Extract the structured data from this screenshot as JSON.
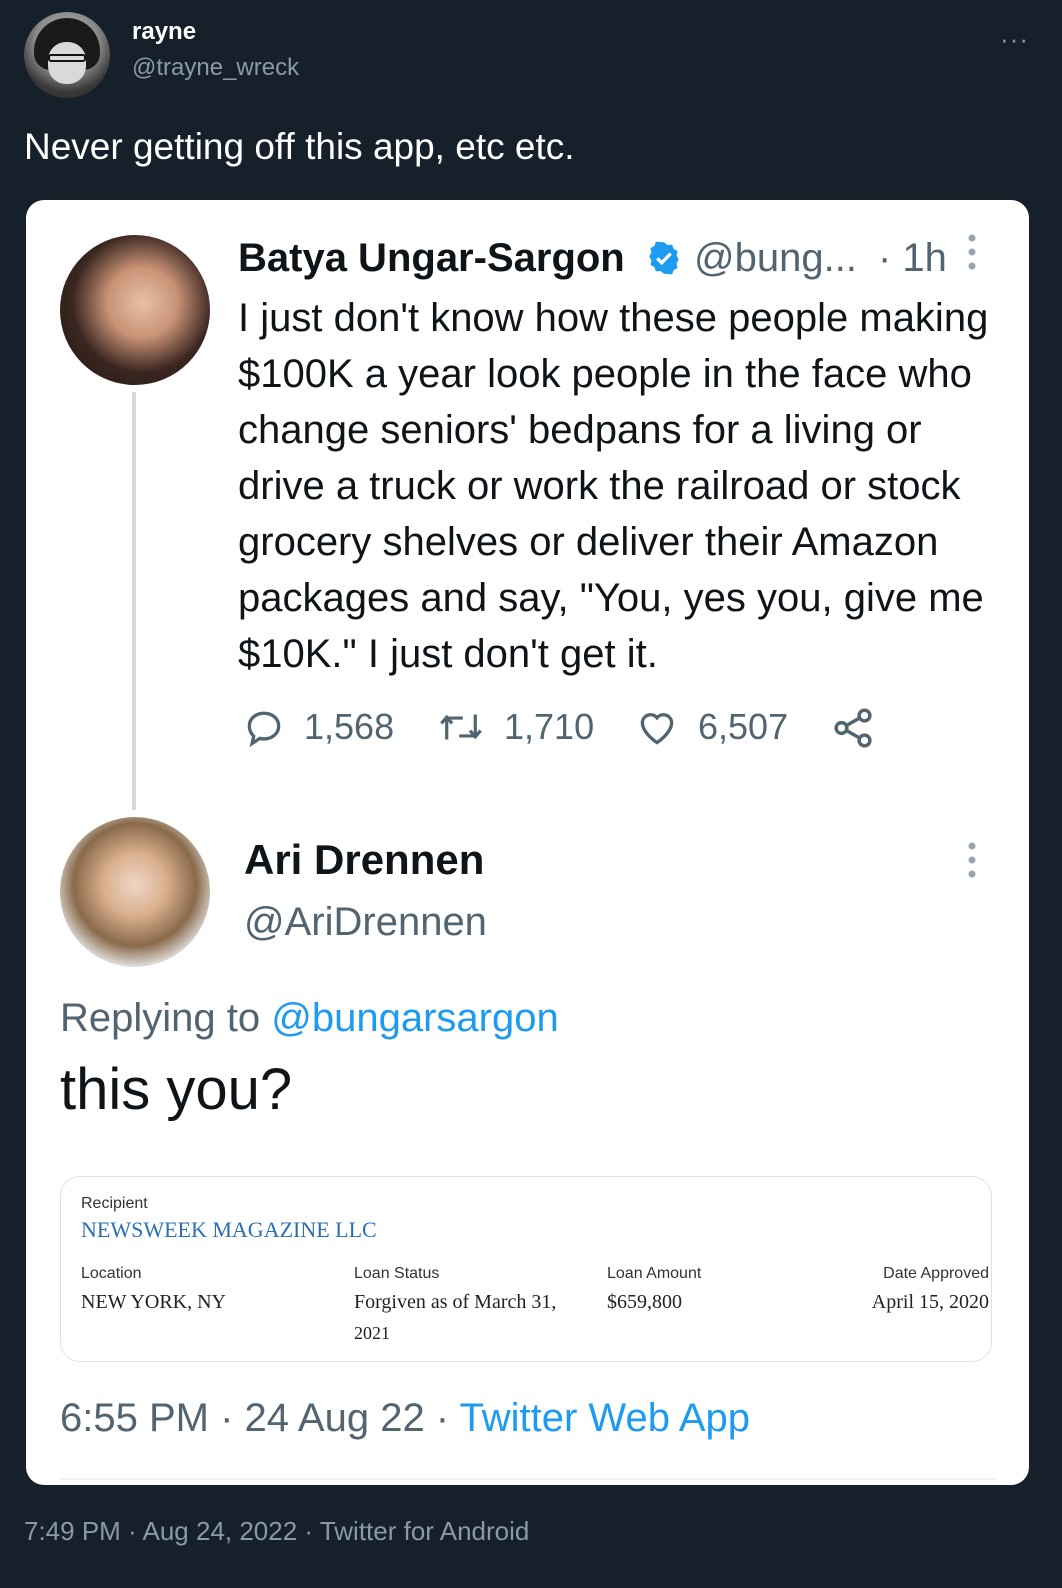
{
  "tweet": {
    "author_name": "rayne",
    "author_handle": "@trayne_wreck",
    "more_label": "···",
    "text": "Never getting off this app, etc etc.",
    "footer": "7:49 PM · Aug 24, 2022 · Twitter for Android"
  },
  "quoted_tweet": {
    "author_name": "Batya Ungar-Sargon",
    "author_handle": "@bung...",
    "time": "· 1h",
    "body": "I just don't know how these people making $100K a year look people in the face who change seniors' bedpans for a living or drive a truck or work the railroad or stock grocery shelves or deliver their Amazon packages and say, \"You, yes you, give me $10K.\" I just don't get it.",
    "replies": "1,568",
    "retweets": "1,710",
    "likes": "6,507"
  },
  "reply": {
    "author_name": "Ari Drennen",
    "author_handle": "@AriDrennen",
    "replying_prefix": "Replying to",
    "replying_to": "@bungarsargon",
    "text": "this you?",
    "timestamp": "6:55 PM · 24 Aug 22 ·",
    "source": "Twitter Web App"
  },
  "loan_record": {
    "recipient_label": "Recipient",
    "recipient": "NEWSWEEK MAGAZINE LLC",
    "location_label": "Location",
    "location": "NEW YORK, NY",
    "status_label": "Loan Status",
    "status_line1": "Forgiven as of March 31,",
    "status_line2": "2021",
    "amount_label": "Loan Amount",
    "amount": "$659,800",
    "date_label": "Date Approved",
    "date": "April 15, 2020"
  },
  "colors": {
    "background": "#15202b",
    "link": "#1d9bf0",
    "muted": "#536471",
    "verified": "#1d9bf0"
  }
}
